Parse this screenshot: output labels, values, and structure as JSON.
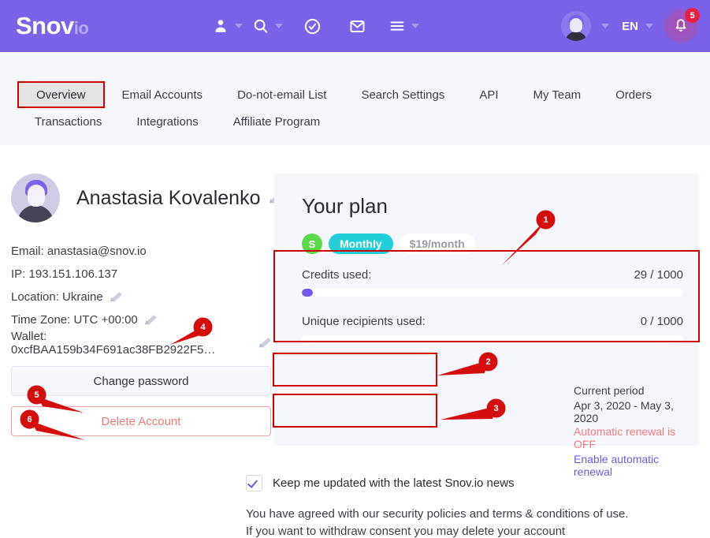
{
  "header": {
    "logo_main": "Snov",
    "logo_suffix": "io",
    "icons": [
      {
        "name": "person-icon",
        "caret": true
      },
      {
        "name": "search-icon",
        "caret": true
      },
      {
        "name": "check-circle-icon",
        "caret": false
      },
      {
        "name": "mail-icon",
        "caret": false
      },
      {
        "name": "menu-icon",
        "caret": true
      }
    ],
    "avatar_name": "user-avatar",
    "language": "EN",
    "notifications_count": "5"
  },
  "tabs": {
    "row1": [
      "Overview",
      "Email Accounts",
      "Do-not-email List",
      "Search Settings",
      "API",
      "My Team",
      "Orders"
    ],
    "row2": [
      "Transactions",
      "Integrations",
      "Affiliate Program"
    ],
    "active": "Overview"
  },
  "profile": {
    "name": "Anastasia Kovalenko",
    "info": [
      {
        "text": "Email: anastasia@snov.io",
        "editable": false
      },
      {
        "text": "IP: 193.151.106.137",
        "editable": false
      },
      {
        "text": "Location: Ukraine",
        "editable": true
      },
      {
        "text": "Time Zone: UTC +00:00",
        "editable": true
      },
      {
        "text": "Wallet: 0xcfBAA159b34F691ac38FB2922F5…",
        "editable": true
      }
    ],
    "change_password_label": "Change password",
    "delete_account_label": "Delete Account"
  },
  "plan": {
    "title": "Your plan",
    "badge_tier": "S",
    "badge_period": "Monthly",
    "badge_price": "$19/month",
    "credits_label": "Credits used:",
    "credits_value": "29 / 1000",
    "credits_percent": 2.9,
    "recipients_label": "Unique recipients used:",
    "recipients_value": "0 / 1000",
    "recipients_percent": 0,
    "current_period_label": "Current period",
    "current_period_value": "Apr 3, 2020 - May 3, 2020",
    "auto_renew_status": "Automatic renewal is OFF",
    "auto_renew_link": "Enable automatic renewal"
  },
  "consent": {
    "checkbox_label": "Keep me updated with the latest Snov.io news",
    "legal_line1": "You have agreed with our security policies and terms & conditions of use.",
    "legal_line2": "If you want to withdraw consent you may delete your account"
  },
  "annotations": {
    "markers": [
      "1",
      "2",
      "3",
      "4",
      "5",
      "6"
    ]
  },
  "colors": {
    "brand_purple": "#7a63e8",
    "accent_purple": "#7258ec",
    "annotation_red": "#cc0000",
    "badge_green": "#5ed84b",
    "badge_teal": "#22cfd8",
    "danger_red": "#e8203e",
    "soft_red": "#f37878"
  }
}
